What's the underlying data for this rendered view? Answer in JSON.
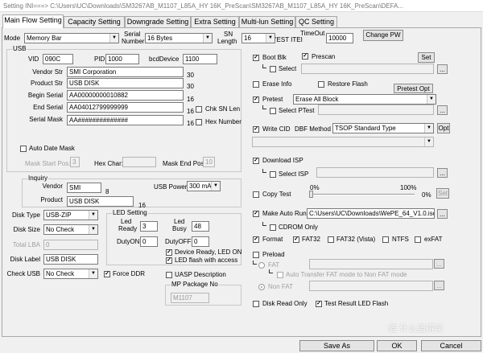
{
  "window": {
    "title": "Setting  INI===> C:\\Users\\UC\\Downloads\\SM3267AB_M1107_L85A_HY 16K_PreScan\\SM3267AB_M1107_L85A_HY 16K_PreScan\\DEFA..."
  },
  "tabs": [
    "Main Flow Setting",
    "Capacity Setting",
    "Downgrade Setting",
    "Extra Setting",
    "Multi-lun Setting",
    "QC Setting"
  ],
  "top": {
    "mode_label": "Mode",
    "mode_value": "Memory Bar",
    "serial_label1": "Serial",
    "serial_label2": "Number",
    "serial_value": "16 Bytes",
    "sn_label1": "SN",
    "sn_label2": "Length",
    "sn_value": "16",
    "test_item_label": "'EST ITEI",
    "timeout_label": "TimeOut",
    "timeout_value": "10000",
    "change_pw": "Change PW"
  },
  "usb": {
    "title": "USB",
    "vid_label": "VID",
    "vid": "090C",
    "pid_label": "PID",
    "pid": "1000",
    "bcd_label": "bcdDevice",
    "bcd": "1100",
    "vendor_label": "Vendor Str",
    "vendor": "SMI Corporation",
    "vendor_len": "30",
    "product_label": "Product Str",
    "product": "USB DISK",
    "product_len": "30",
    "begin_label": "Begin Serial",
    "begin": "AA00000000010882",
    "begin_len": "16",
    "end_label": "End Serial",
    "end": "AA04012799999999",
    "end_len": "16",
    "chk_sn": "Chk SN Len",
    "mask_label": "Serial Mask",
    "mask": "AA##############",
    "mask_len": "16",
    "hex_num": "Hex Number",
    "auto_date": "Auto Date Mask",
    "mask_start_label": "Mask Start Pos:",
    "mask_start": "3",
    "hex_char_label": "Hex Char:",
    "mask_end_label": "Mask End Pos:",
    "mask_end": "10"
  },
  "inquiry": {
    "title": "Inquiry",
    "vendor_label": "Vendor",
    "vendor": "SMI",
    "vendor_len": "8",
    "product_label": "Product",
    "product": "USB DISK",
    "product_len": "16",
    "usb_power_label": "USB Power",
    "usb_power": "300 mA"
  },
  "disk": {
    "type_label": "Disk Type",
    "type": "USB-ZIP",
    "size_label": "Disk Size",
    "size": "No Check",
    "lba_label": "Total LBA",
    "lba": "0",
    "label_label": "Disk Label",
    "label": "USB DISK",
    "check_label": "Check USB",
    "check": "No Check",
    "force_ddr": "Force DDR"
  },
  "led": {
    "title": "LED Setting",
    "ready_label1": "Led",
    "ready_label2": "Ready",
    "ready": "3",
    "busy_label1": "Led",
    "busy_label2": "Busy",
    "busy": "48",
    "dutyon_label": "DutyON",
    "dutyon": "0",
    "dutyoff_label": "DutyOFF",
    "dutyoff": "0",
    "device_ready": "Device Ready, LED ON",
    "led_flash": "LED flash with access",
    "uasp": "UASP Description",
    "mp_title": "MP Package No",
    "mp": "M1107"
  },
  "right": {
    "boot_blk": "Boot Blk",
    "prescan": "Prescan",
    "set": "Set",
    "select": "Select",
    "erase_info": "Erase Info",
    "restore_flash": "Restore Flash",
    "pretest_opt": "Pretest Opt",
    "pretest": "Pretest",
    "pretest_value": "Erase All Block",
    "select_ptest": "Select PTest",
    "write_cid": "Write CID",
    "dbf_label": "DBF Method",
    "dbf_value": "TSOP Standard Type",
    "opt": "Opt",
    "download_isp": "Download ISP",
    "select_isp": "Select ISP",
    "copy_test": "Copy Test",
    "pct0": "0%",
    "pct100": "100%",
    "pct_cur": "0%",
    "copy_set": "Set",
    "make_auto_run": "Make Auto Run",
    "auto_run_path": "C:\\Users\\UC\\Downloads\\WePE_64_V1.0.iso",
    "browse": "...",
    "cdrom_only": "CDROM Only",
    "format": "Format",
    "fat32": "FAT32",
    "fat32_vista": "FAT32 (Vista)",
    "ntfs": "NTFS",
    "exfat": "exFAT",
    "preload": "Preload",
    "fat": "FAT",
    "auto_transfer": "Auto Transfer FAT mode to Non FAT mode",
    "non_fat": "Non FAT",
    "disk_read_only": "Disk Read Only",
    "test_result_led": "Test Result LED Flash"
  },
  "bottom": {
    "save_as": "Save  As",
    "ok": "OK",
    "cancel": "Cancel"
  },
  "watermark": "值 什么值得买"
}
